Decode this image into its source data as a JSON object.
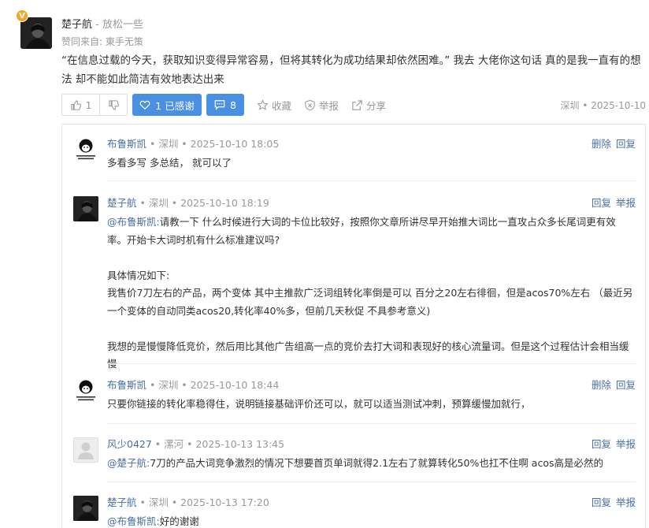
{
  "main": {
    "badge": "V",
    "author": "楚子航",
    "separator": " - ",
    "signature": "放松一些",
    "source": "赞同来自: 東手无策",
    "text": "“在信息过载的今天，获取知识变得异常容易，但将其转化为成功结果却依然困难。” 我去 大佬你这句话 真的是我一直有的想法 却不能如此简洁有效地表达出来",
    "upvotes": "1",
    "thanks_label": "1 已感谢",
    "comments_count": "8",
    "collect_label": "收藏",
    "report_label": "举报",
    "share_label": "分享",
    "meta": "深圳 • 2025-10-10"
  },
  "replies": [
    {
      "author": "布鲁斯凯",
      "meta": " • 深圳 • 2025-10-10 18:05",
      "op1": "删除",
      "op2": "回复",
      "lines": [
        "多看多写 多总结， 就可以了"
      ]
    },
    {
      "author": "楚子航",
      "meta": " • 深圳 • 2025-10-10 18:19",
      "op1": "回复",
      "op2": "举报",
      "mention": "@布鲁斯凯:",
      "lines": [
        "请教一下 什么时候进行大词的卡位比较好，按照你文章所讲尽早开始推大词比一直攻占众多长尾词更有效率。开始卡大词时机有什么标准建议吗?",
        "",
        "具体情况如下:",
        "我售价7刀左右的产品，两个变体 其中主推款广泛词组转化率倒是可以 百分之20左右徘徊，但是acos70%左右 （最近另一个变体的自动同类acos20,转化率40%多，但前几天秋促 不具参考意义)",
        "",
        "我想的是慢慢降低竞价，然后用比其他广告组高一点的竞价去打大词和表现好的核心流量词。但是这个过程估计会相当缓慢"
      ]
    },
    {
      "author": "布鲁斯凯",
      "meta": " • 深圳 • 2025-10-10 18:44",
      "op1": "删除",
      "op2": "回复",
      "lines": [
        "只要你链接的转化率稳得住，说明链接基础评价还可以，就可以适当测试冲刺，预算缓慢加就行，"
      ]
    },
    {
      "author": "风少0427",
      "meta": " • 漯河 • 2025-10-13 13:45",
      "op1": "回复",
      "op2": "举报",
      "mention": "@楚子航:",
      "lines": [
        "7刀的产品大词竞争激烈的情况下想要首页单词就得2.1左右了就算转化50%也扛不住啊 acos高是必然的"
      ]
    },
    {
      "author": "楚子航",
      "meta": " • 深圳 • 2025-10-13 17:20",
      "op1": "回复",
      "op2": "举报",
      "mention": "@布鲁斯凯:",
      "lines": [
        "好的谢谢"
      ]
    }
  ],
  "icons": {
    "thumb_up": "thumb-up-icon",
    "thumb_down": "thumb-down-icon",
    "heart": "heart-icon",
    "comment": "comment-icon",
    "star": "star-icon",
    "shield": "shield-icon",
    "share": "share-icon"
  },
  "colors": {
    "accent": "#4a90e2",
    "link": "#4a6fa5",
    "muted": "#999999",
    "badge": "#f5a623"
  }
}
